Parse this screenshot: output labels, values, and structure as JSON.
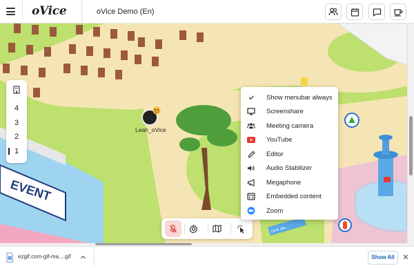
{
  "topbar": {
    "logo": "oVice",
    "space_title": "oVice Demo (En)",
    "icons": [
      "menu-icon",
      "users-icon",
      "calendar-icon",
      "chat-icon",
      "coffee-icon"
    ]
  },
  "floor_panel": {
    "icon": "building-icon",
    "floors": [
      "4",
      "3",
      "2",
      "1"
    ],
    "current_floor": "1"
  },
  "map": {
    "event_sign": "EVENT",
    "giveaway_sign": "Give aw..."
  },
  "avatar": {
    "name": "Leah_oVice"
  },
  "menu": {
    "items": [
      {
        "label": "Show menubar always",
        "icon": "check-icon"
      },
      {
        "label": "Screenshare",
        "icon": "monitor-icon"
      },
      {
        "label": "Meeting camera",
        "icon": "group-icon"
      },
      {
        "label": "YouTube",
        "icon": "youtube-icon"
      },
      {
        "label": "Editor",
        "icon": "pencil-icon"
      },
      {
        "label": "Audio Stabilizer",
        "icon": "speaker-icon"
      },
      {
        "label": "Megaphone",
        "icon": "megaphone-icon"
      },
      {
        "label": "Embedded content",
        "icon": "embed-icon"
      },
      {
        "label": "Zoom",
        "icon": "zoom-icon"
      }
    ]
  },
  "bottom_toolbar": {
    "buttons": [
      "mic-muted-icon",
      "settings-icon",
      "map-icon",
      "cursor-click-icon"
    ]
  },
  "downloads": {
    "file_name": "ezgif.com-gif-ma....gif",
    "show_all": "Show All"
  },
  "colors": {
    "grass": "#bde06e",
    "path": "#f6e5b4",
    "mic_muted_bg": "#f9d8d8",
    "youtube_red": "#e53935",
    "zoom_blue": "#2d8cff",
    "link_blue": "#1a5fb4"
  }
}
